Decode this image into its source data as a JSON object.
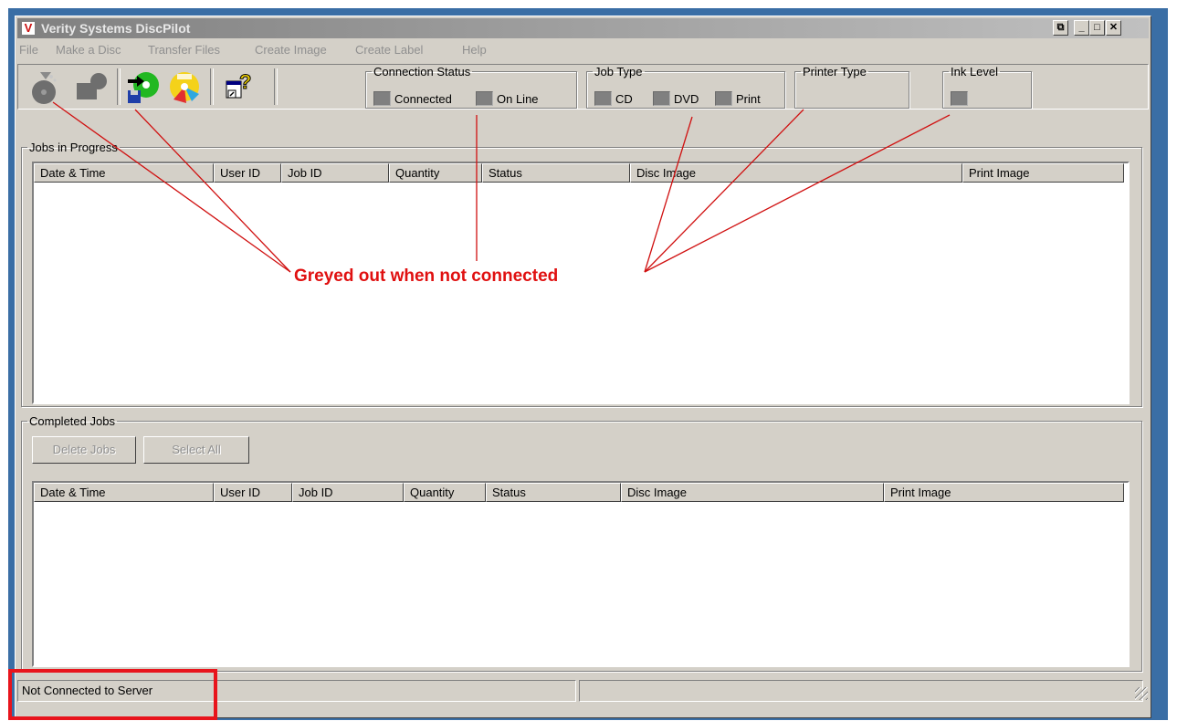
{
  "window": {
    "title": "Verity Systems DiscPilot"
  },
  "caption_buttons": [
    "restore",
    "minimize",
    "maximize",
    "close"
  ],
  "menu": [
    "File",
    "Make a Disc",
    "Transfer Files",
    "Create Image",
    "Create Label",
    "Help"
  ],
  "toolbar": {
    "tools": [
      "disc-eject-icon",
      "disc-tray-icon",
      "transfer-files-icon",
      "create-image-icon",
      "create-label-icon",
      "help-icon"
    ]
  },
  "connection_status": {
    "legend": "Connection Status",
    "connected": "Connected",
    "online": "On Line"
  },
  "job_type": {
    "legend": "Job Type",
    "cd": "CD",
    "dvd": "DVD",
    "print": "Print"
  },
  "printer_type": {
    "legend": "Printer Type"
  },
  "ink_level": {
    "legend": "Ink Level"
  },
  "jobs_in_progress": {
    "legend": "Jobs in Progress",
    "columns": [
      "Date & Time",
      "User ID",
      "Job ID",
      "Quantity",
      "Status",
      "Disc Image",
      "Print Image"
    ]
  },
  "completed_jobs": {
    "legend": "Completed Jobs",
    "delete_label": "Delete Jobs",
    "select_all_label": "Select All",
    "columns": [
      "Date & Time",
      "User ID",
      "Job ID",
      "Quantity",
      "Status",
      "Disc Image",
      "Print Image"
    ]
  },
  "status_bar": {
    "message": "Not Connected to Server",
    "secondary": ""
  },
  "annotation": {
    "text": "Greyed out when not connected",
    "color": "#e01010"
  },
  "colors": {
    "desktop": "#3a6ea5",
    "window": "#d4d0c8",
    "title_inactive": "#808080",
    "led_off": "#808080",
    "highlight": "#e8141c"
  }
}
